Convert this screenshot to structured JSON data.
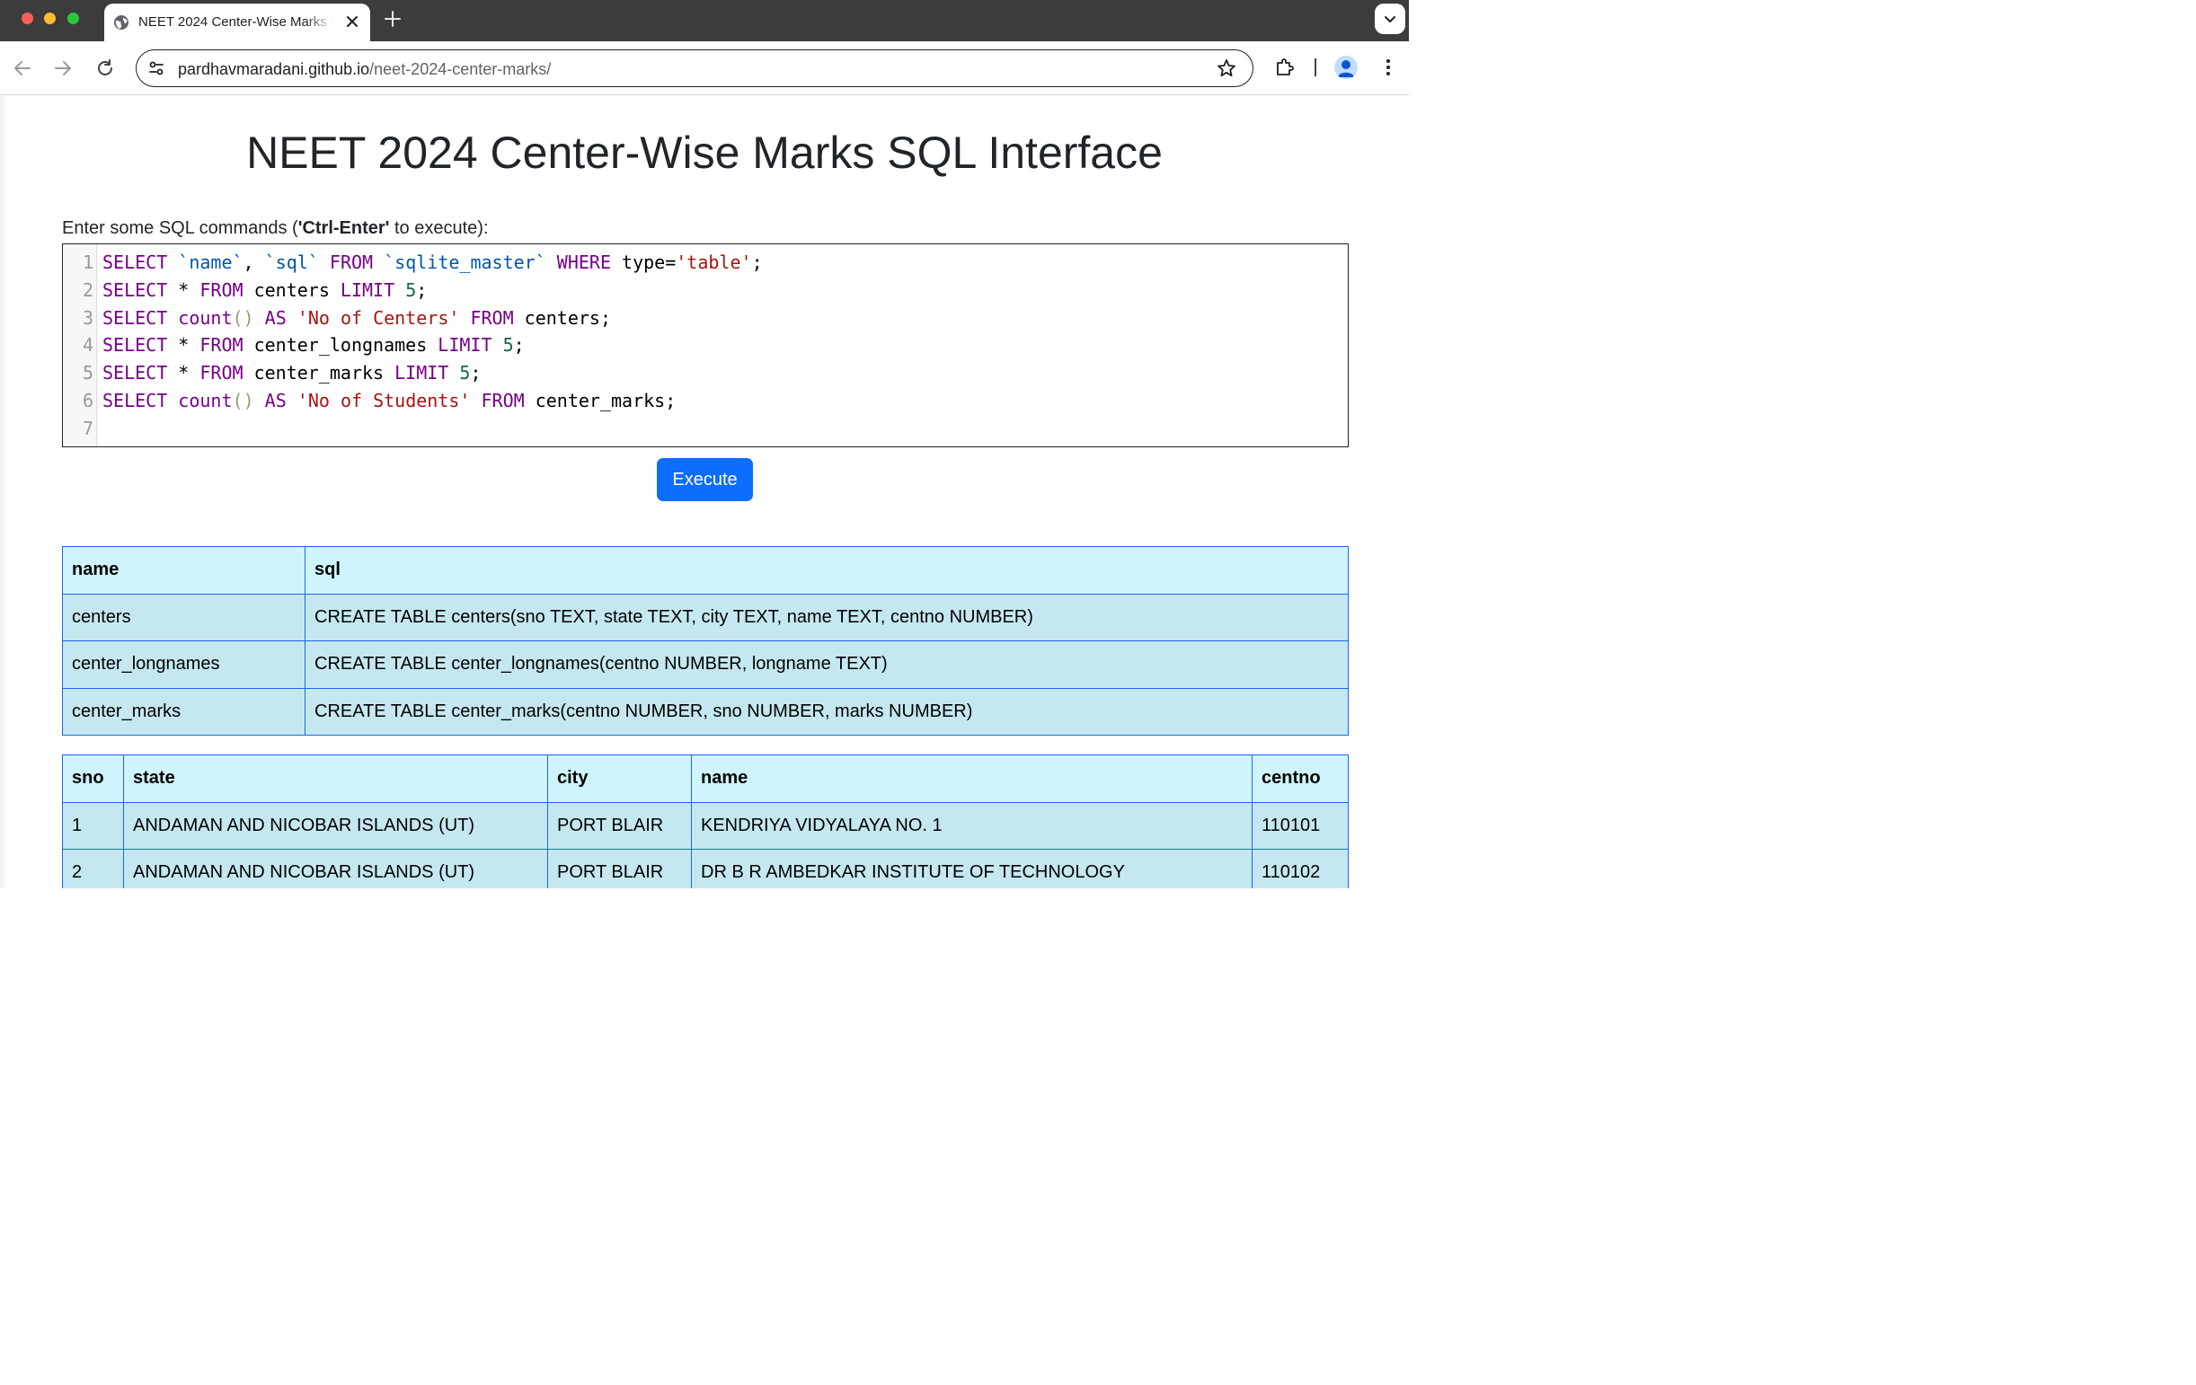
{
  "browser": {
    "tab_title": "NEET 2024 Center-Wise Marks SQL Interface",
    "url_host": "pardhavmaradani.github.io",
    "url_path": "/neet-2024-center-marks/"
  },
  "page": {
    "title": "NEET 2024 Center-Wise Marks SQL Interface",
    "prompt_pre": "Enter some SQL commands (",
    "prompt_bold": "'Ctrl-Enter'",
    "prompt_post": " to execute):",
    "execute_label": "Execute"
  },
  "editor": {
    "line_numbers": [
      "1",
      "2",
      "3",
      "4",
      "5",
      "6",
      "7"
    ],
    "lines": [
      "SELECT `name`, `sql` FROM `sqlite_master` WHERE type='table';",
      "SELECT * FROM centers LIMIT 5;",
      "SELECT count() AS 'No of Centers' FROM centers;",
      "SELECT * FROM center_longnames LIMIT 5;",
      "SELECT * FROM center_marks LIMIT 5;",
      "SELECT count() AS 'No of Students' FROM center_marks;",
      ""
    ]
  },
  "tables": [
    {
      "headers": [
        "name",
        "sql"
      ],
      "rows": [
        [
          "centers",
          "CREATE TABLE centers(sno TEXT, state TEXT, city TEXT, name TEXT, centno NUMBER)"
        ],
        [
          "center_longnames",
          "CREATE TABLE center_longnames(centno NUMBER, longname TEXT)"
        ],
        [
          "center_marks",
          "CREATE TABLE center_marks(centno NUMBER, sno NUMBER, marks NUMBER)"
        ]
      ]
    },
    {
      "headers": [
        "sno",
        "state",
        "city",
        "name",
        "centno"
      ],
      "rows": [
        [
          "1",
          "ANDAMAN AND NICOBAR ISLANDS (UT)",
          "PORT BLAIR",
          "KENDRIYA VIDYALAYA NO. 1",
          "110101"
        ],
        [
          "2",
          "ANDAMAN AND NICOBAR ISLANDS (UT)",
          "PORT BLAIR",
          "DR B R AMBEDKAR INSTITUTE OF TECHNOLOGY",
          "110102"
        ]
      ]
    }
  ]
}
